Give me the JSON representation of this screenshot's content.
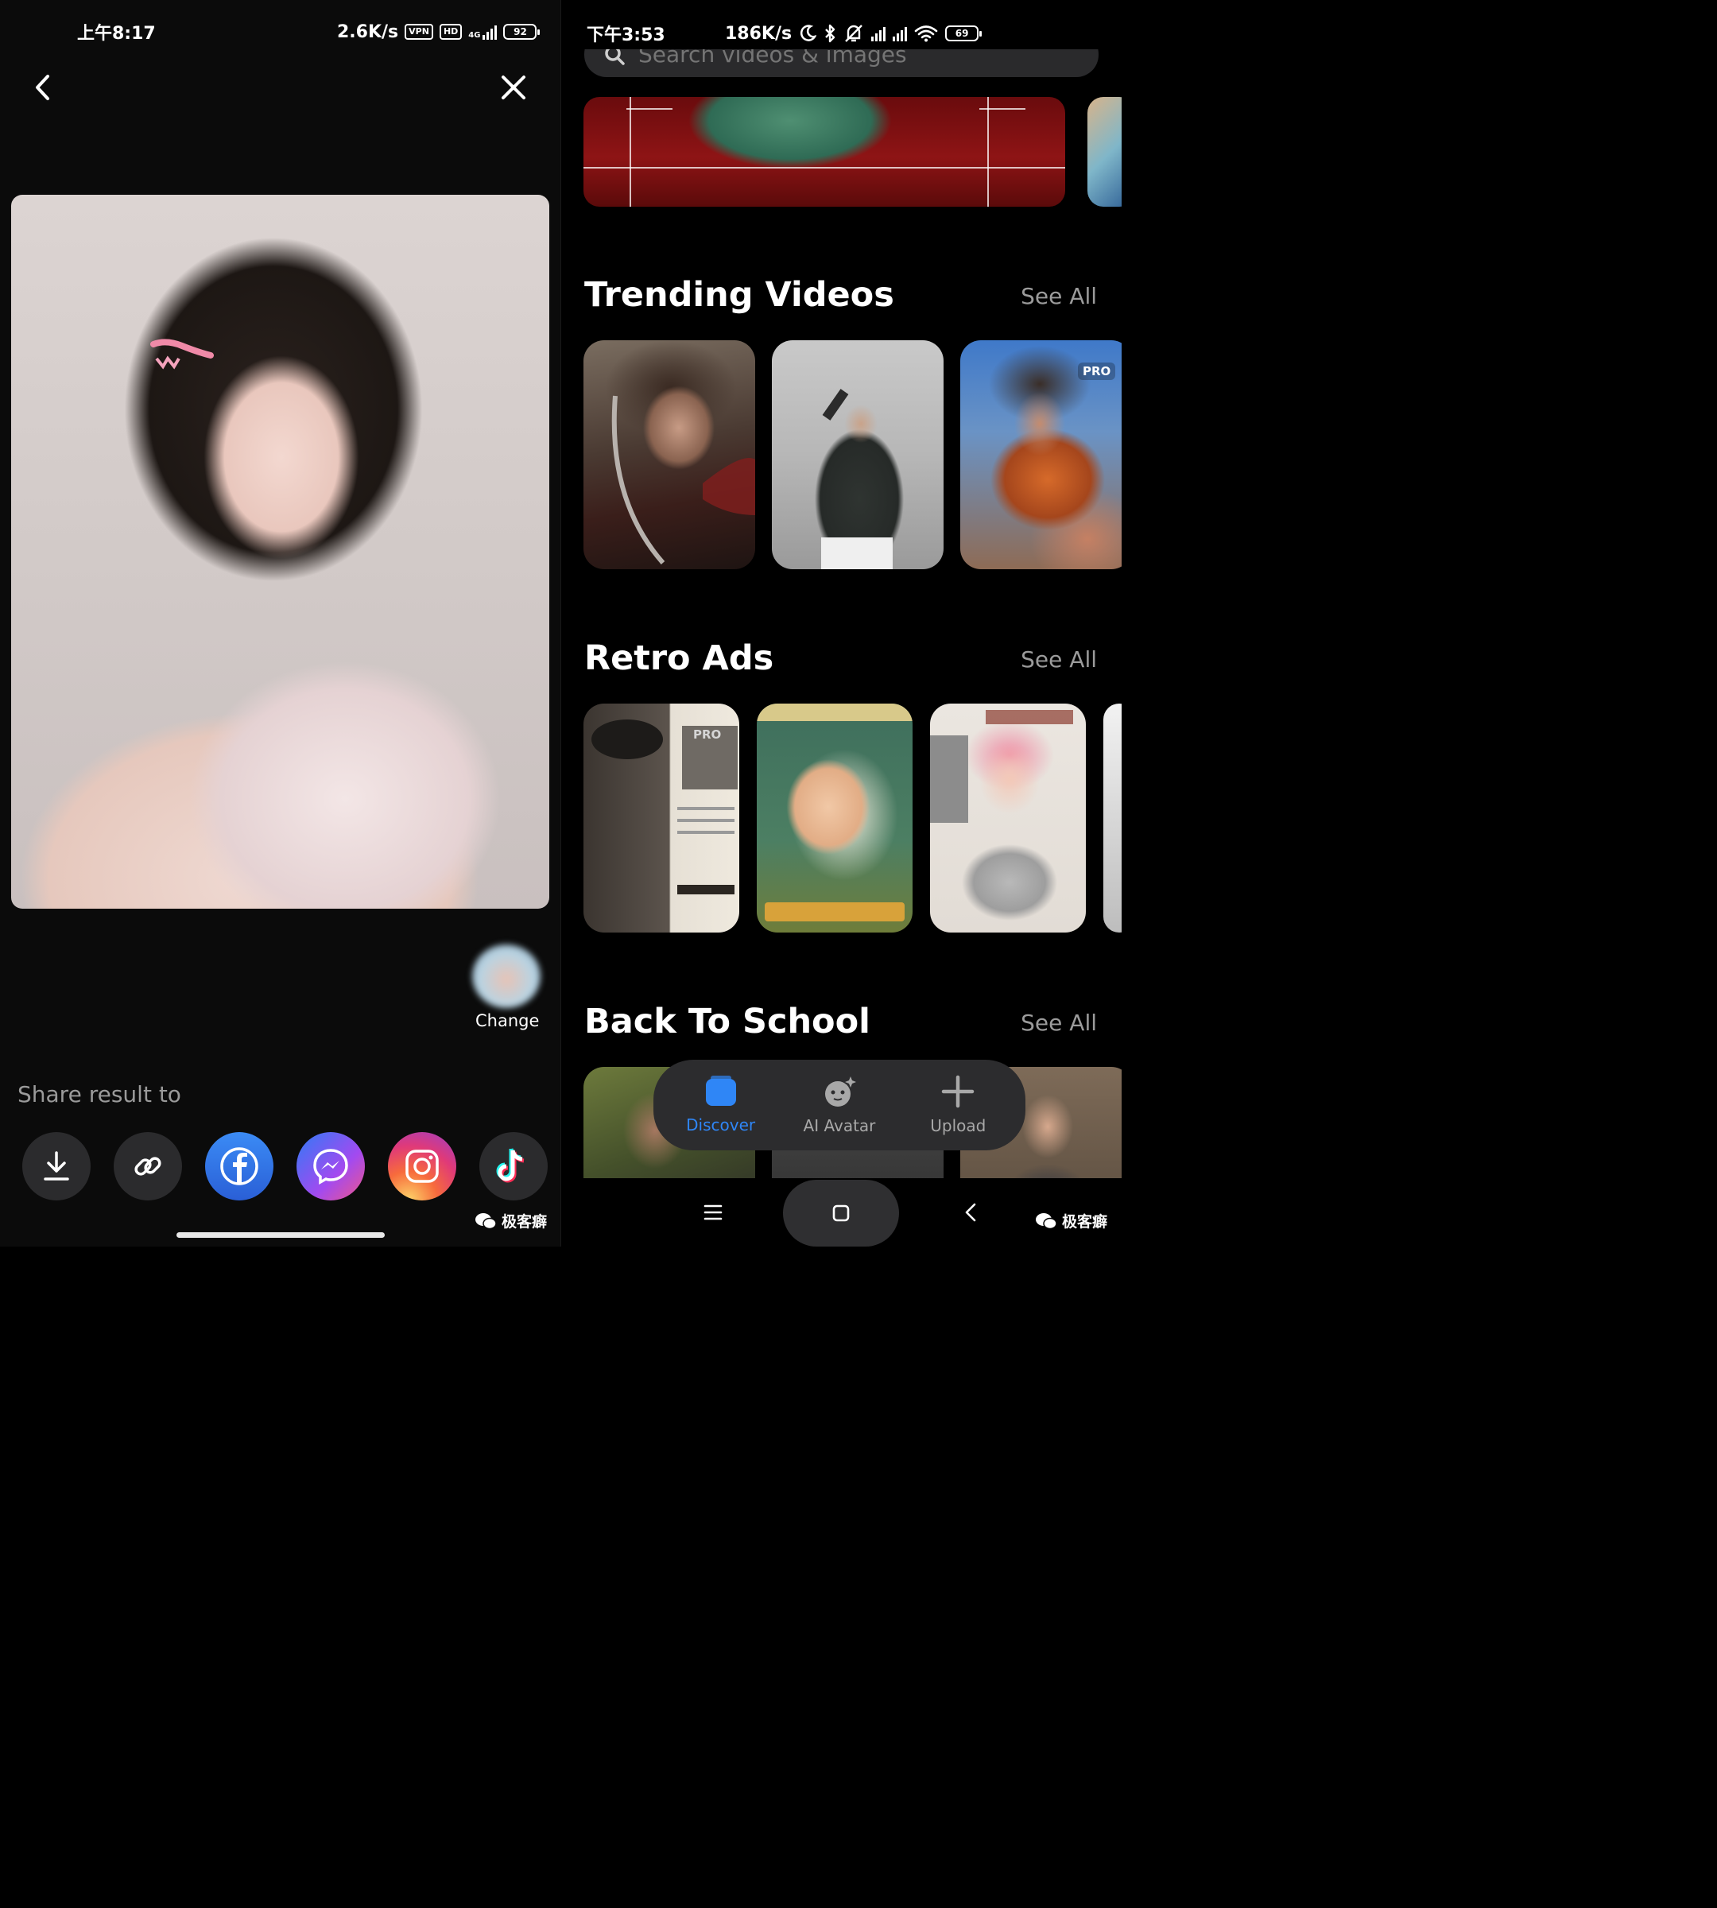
{
  "left": {
    "status": {
      "time": "上午8:17",
      "speed": "2.6K/s",
      "vpn": "VPN",
      "hd": "HD",
      "net": "4G",
      "battery": "92"
    },
    "change_label": "Change",
    "share_label": "Share result to",
    "share_buttons": [
      {
        "name": "download-icon",
        "color": "#2b2b2d"
      },
      {
        "name": "link-icon",
        "color": "#2b2b2d"
      },
      {
        "name": "facebook-icon",
        "color": "#2f6fe0"
      },
      {
        "name": "messenger-icon",
        "color": "#8a4cf0"
      },
      {
        "name": "instagram-icon",
        "color": "#e8404f"
      },
      {
        "name": "tiktok-icon",
        "color": "#2b2b2d"
      }
    ],
    "watermark": "极客癖"
  },
  "right": {
    "status": {
      "time": "下午3:53",
      "speed": "186K/s",
      "battery": "69"
    },
    "search": {
      "placeholder": "Search videos & images"
    },
    "sections": [
      {
        "title": "Trending Videos",
        "see_all": "See All"
      },
      {
        "title": "Retro Ads",
        "see_all": "See All"
      },
      {
        "title": "Back To School",
        "see_all": "See All"
      }
    ],
    "pro_badge": "PRO",
    "tabs": [
      {
        "label": "Discover",
        "active": true
      },
      {
        "label": "AI Avatar",
        "active": false
      },
      {
        "label": "Upload",
        "active": false
      }
    ],
    "watermark": "极客癖",
    "accent": "#2f86f6"
  }
}
